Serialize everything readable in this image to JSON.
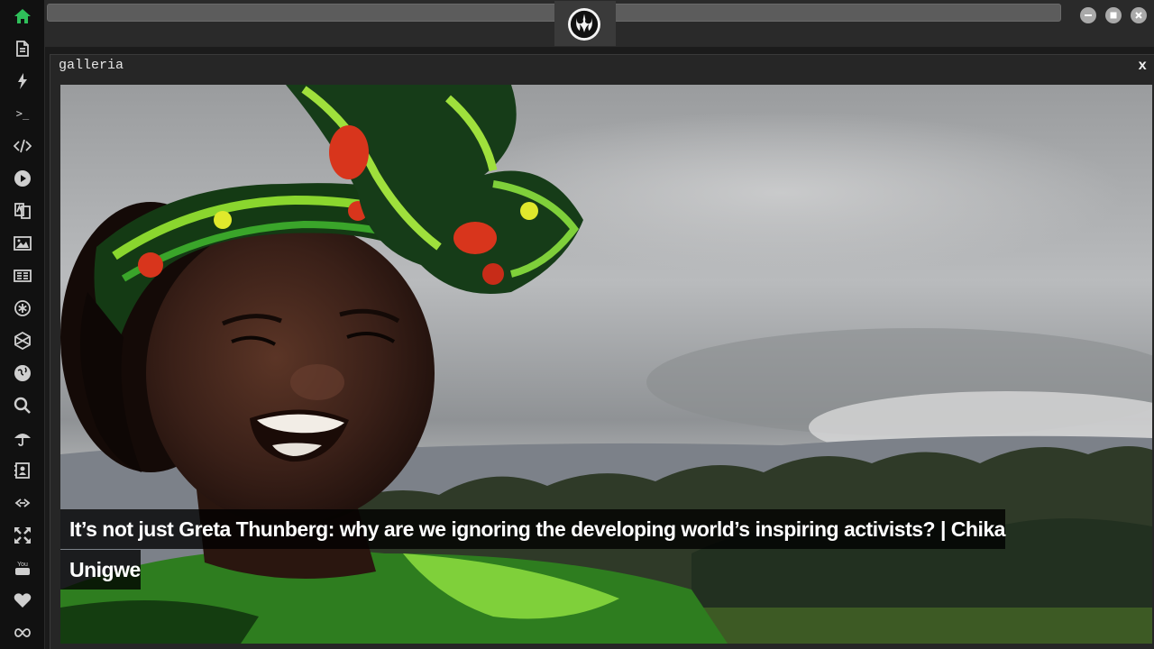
{
  "sidebar": {
    "items": [
      {
        "icon": "home-icon"
      },
      {
        "icon": "document-icon"
      },
      {
        "icon": "lightning-icon"
      },
      {
        "icon": "terminal-icon",
        "glyph": ">_"
      },
      {
        "icon": "code-icon"
      },
      {
        "icon": "play-icon"
      },
      {
        "icon": "translate-icon"
      },
      {
        "icon": "image-icon"
      },
      {
        "icon": "news-icon"
      },
      {
        "icon": "asterisk-icon"
      },
      {
        "icon": "hexagon-icon"
      },
      {
        "icon": "globe-icon"
      },
      {
        "icon": "search-icon"
      },
      {
        "icon": "umbrella-icon"
      },
      {
        "icon": "contact-card-icon"
      },
      {
        "icon": "link-icon"
      },
      {
        "icon": "expand-icon"
      },
      {
        "icon": "youtube-icon",
        "glyph": "You Tube"
      },
      {
        "icon": "heart-icon"
      },
      {
        "icon": "infinity-icon"
      }
    ],
    "active_color": "#2fbf5a"
  },
  "topbar": {
    "logo_icon": "rebel-alliance-icon",
    "window_controls": [
      "minimize-icon",
      "maximize-icon",
      "close-icon"
    ]
  },
  "window": {
    "title": "galleria",
    "close_label": "x",
    "image_caption": "It’s not just Greta Thunberg: why are we ignoring the developing world’s inspiring activists? | Chika Unigwe"
  }
}
